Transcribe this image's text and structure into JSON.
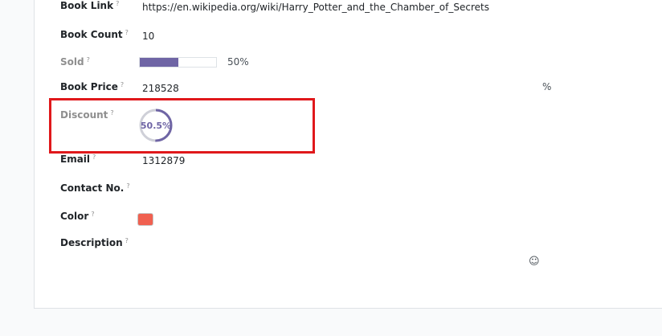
{
  "form": {
    "book_link": {
      "label": "Book Link",
      "help": "?",
      "value": "https://en.wikipedia.org/wiki/Harry_Potter_and_the_Chamber_of_Secrets"
    },
    "book_count": {
      "label": "Book Count",
      "help": "?",
      "value": "10"
    },
    "sold": {
      "label": "Sold",
      "help": "?",
      "progress_percent": 50,
      "progress_text": "50%"
    },
    "book_price": {
      "label": "Book Price",
      "help": "?",
      "value": "218528",
      "suffix": "%"
    },
    "discount": {
      "label": "Discount",
      "help": "?",
      "gauge_percent": 50.5,
      "gauge_text": "50.5%"
    },
    "email": {
      "label": "Email",
      "help": "?",
      "value": "1312879"
    },
    "contact_no": {
      "label": "Contact No.",
      "help": "?",
      "value": ""
    },
    "color": {
      "label": "Color",
      "help": "?",
      "swatch_color": "#f06050"
    },
    "description": {
      "label": "Description",
      "help": "?",
      "value": "",
      "emoji_icon": "smiley-icon"
    }
  },
  "colors": {
    "accent": "#6f65a5",
    "highlight_border": "#e0181b"
  }
}
